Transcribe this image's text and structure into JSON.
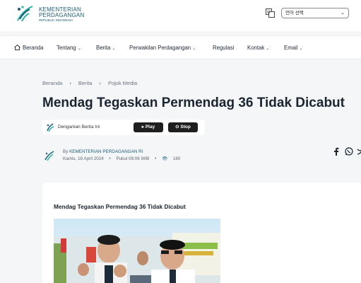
{
  "header": {
    "logo_line1": "KEMENTERIAN",
    "logo_line2": "PERDAGANGAN",
    "logo_line3": "REPUBLIK INDONESIA",
    "language_selected": "언어 선택"
  },
  "nav": {
    "items": [
      {
        "label": "Beranda"
      },
      {
        "label": "Tentang"
      },
      {
        "label": "Berita"
      },
      {
        "label": "Perwakilan Perdagangan"
      },
      {
        "label": "Regulasi"
      },
      {
        "label": "Kontak"
      },
      {
        "label": "Email"
      }
    ]
  },
  "breadcrumb": [
    "Beranda",
    "Berita",
    "Pojok Media"
  ],
  "article": {
    "title": "Mendag Tegaskan Permendag 36 Tidak Dicabut",
    "audio_label": "Dengarkan Berita Ini",
    "play_label": "Play",
    "stop_label": "Stop",
    "author_prefix": "By",
    "author": "KEMENTERIAN PERDAGANGAN RI",
    "date": "Kamis, 18 April 2024",
    "time": "Pukul 09:06 WIB",
    "views": "160",
    "card_title": "Mendag Tegaskan Permendag 36 Tidak Dicabut"
  },
  "colors": {
    "brand": "#1b5e7a",
    "accent": "#2bb3a3",
    "button": "#1f1f1f"
  },
  "icons": [
    "logo-icon",
    "translate-icon",
    "home-icon",
    "play-icon",
    "stop-icon",
    "eye-icon",
    "facebook-icon",
    "whatsapp-icon",
    "twitter-icon"
  ]
}
